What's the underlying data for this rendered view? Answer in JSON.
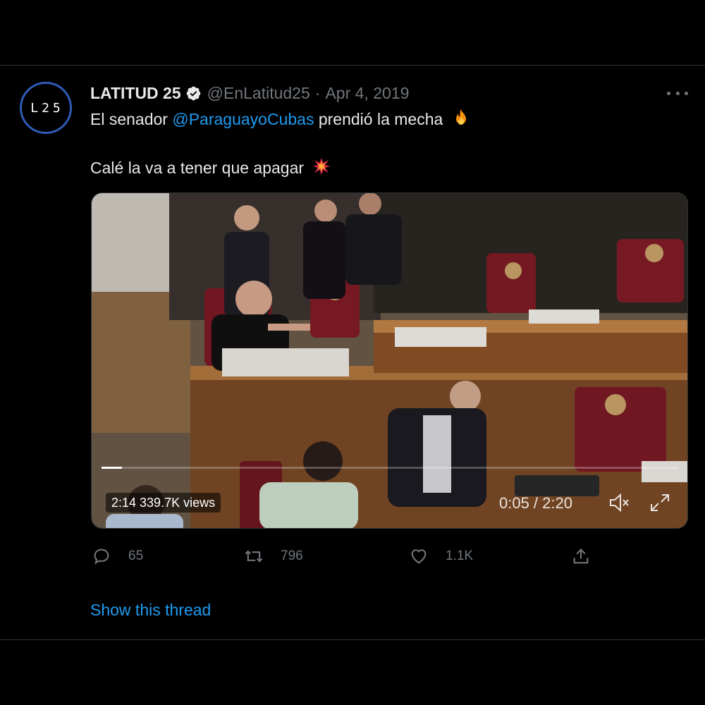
{
  "tweet": {
    "avatar_text": "L25",
    "author_name": "LATITUD 25",
    "verified_icon": "verified-badge-icon",
    "handle": "@EnLatitud25",
    "separator": "·",
    "date": "Apr 4, 2019",
    "more_icon": "more-options-icon",
    "line1_prefix": "El senador",
    "line1_mention": "@ParaguayoCubas",
    "line1_suffix": "prendió la mecha",
    "line1_emoji": "fire-emoji",
    "line2_text": "Calé la va a tener que apagar",
    "line2_emoji": "collision-emoji"
  },
  "video": {
    "duration_views": "2:14 339.7K views",
    "timer": "0:05 / 2:20",
    "progress_fraction": 0.036,
    "mute_icon": "volume-muted-icon",
    "fullscreen_icon": "fullscreen-icon"
  },
  "actions": {
    "reply_count": "65",
    "retweet_count": "796",
    "like_count": "1.1K"
  },
  "show_thread": "Show this thread",
  "colors": {
    "background": "#000000",
    "text": "#e7e9ea",
    "secondary": "#71767b",
    "link": "#1d9bf0",
    "avatar_ring": "#2f5bb7"
  }
}
